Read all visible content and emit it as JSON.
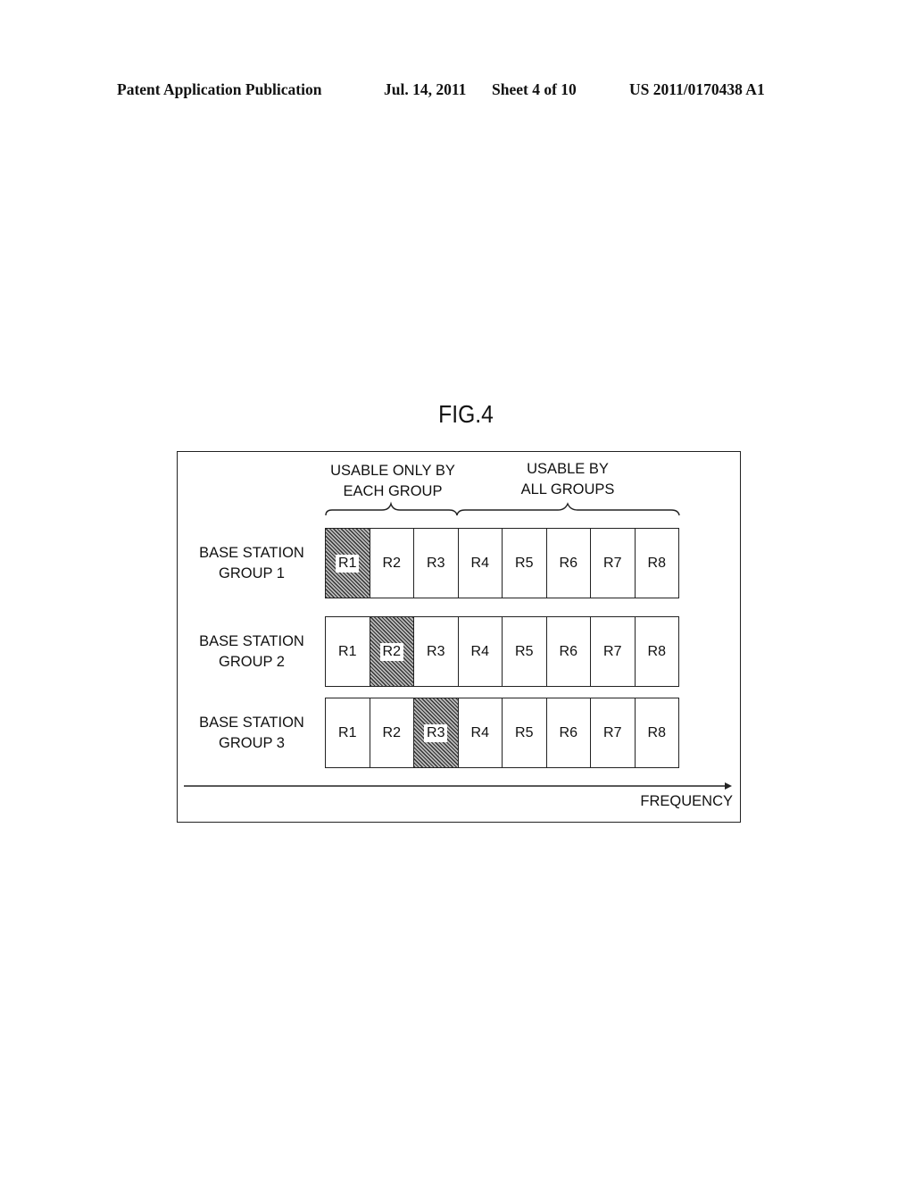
{
  "header": {
    "publication": "Patent Application Publication",
    "date": "Jul. 14, 2011",
    "sheet": "Sheet 4 of 10",
    "number": "US 2011/0170438 A1"
  },
  "figure": {
    "title": "FIG.4",
    "captions": {
      "each_group_line1": "USABLE ONLY BY",
      "each_group_line2": "EACH GROUP",
      "all_groups_line1": "USABLE BY",
      "all_groups_line2": "ALL GROUPS"
    },
    "groups": [
      {
        "line1": "BASE STATION",
        "line2": "GROUP 1",
        "exclusive": "R1"
      },
      {
        "line1": "BASE STATION",
        "line2": "GROUP 2",
        "exclusive": "R2"
      },
      {
        "line1": "BASE STATION",
        "line2": "GROUP 3",
        "exclusive": "R3"
      }
    ],
    "resources": [
      "R1",
      "R2",
      "R3",
      "R4",
      "R5",
      "R6",
      "R7",
      "R8"
    ],
    "axis_label": "FREQUENCY"
  }
}
